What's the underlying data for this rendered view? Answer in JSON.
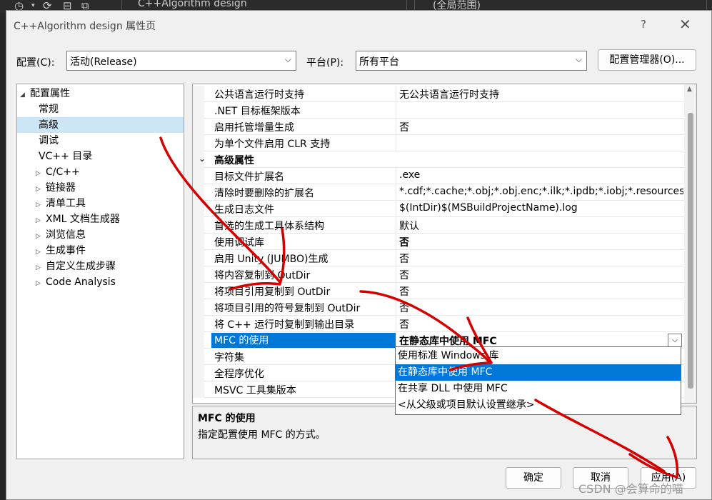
{
  "ide": {
    "tab_title": "C++Algorithm design",
    "scope": "(全局范围)"
  },
  "dialog": {
    "title": "C++Algorithm design 属性页",
    "help": "?",
    "close": "✕"
  },
  "config": {
    "label": "配置(C):",
    "value": "活动(Release)",
    "platform_label": "平台(P):",
    "platform_value": "所有平台",
    "manager_button": "配置管理器(O)..."
  },
  "tree": [
    {
      "label": "配置属性",
      "expander": "◢"
    },
    {
      "label": "常规",
      "expander": ""
    },
    {
      "label": "高级",
      "expander": "",
      "selected": true
    },
    {
      "label": "调试",
      "expander": ""
    },
    {
      "label": "VC++ 目录",
      "expander": ""
    },
    {
      "label": "C/C++",
      "expander": "▷"
    },
    {
      "label": "链接器",
      "expander": "▷"
    },
    {
      "label": "清单工具",
      "expander": "▷"
    },
    {
      "label": "XML 文档生成器",
      "expander": "▷"
    },
    {
      "label": "浏览信息",
      "expander": "▷"
    },
    {
      "label": "生成事件",
      "expander": "▷"
    },
    {
      "label": "自定义生成步骤",
      "expander": "▷"
    },
    {
      "label": "Code Analysis",
      "expander": "▷"
    }
  ],
  "grid": {
    "rows": [
      {
        "name": "公共语言运行时支持",
        "value": "无公共语言运行时支持"
      },
      {
        "name": ".NET 目标框架版本",
        "value": ""
      },
      {
        "name": "启用托管增量生成",
        "value": "否"
      },
      {
        "name": "为单个文件启用 CLR 支持",
        "value": ""
      },
      {
        "name": "高级属性",
        "value": "",
        "category": true,
        "expander": "⌄"
      },
      {
        "name": "目标文件扩展名",
        "value": ".exe"
      },
      {
        "name": "清除时要删除的扩展名",
        "value": "*.cdf;*.cache;*.obj;*.obj.enc;*.ilk;*.ipdb;*.iobj;*.resources"
      },
      {
        "name": "生成日志文件",
        "value": "$(IntDir)$(MSBuildProjectName).log"
      },
      {
        "name": "首选的生成工具体系结构",
        "value": "默认"
      },
      {
        "name": "使用调试库",
        "value": "否",
        "bold": true
      },
      {
        "name": "启用 Unity (JUMBO)生成",
        "value": "否"
      },
      {
        "name": "将内容复制到 OutDir",
        "value": "否"
      },
      {
        "name": "将项目引用复制到 OutDir",
        "value": "否"
      },
      {
        "name": "将项目引用的符号复制到 OutDir",
        "value": "否"
      },
      {
        "name": "将 C++ 运行时复制到输出目录",
        "value": "否"
      },
      {
        "name": "MFC 的使用",
        "value": "在静态库中使用 MFC",
        "selected": true,
        "bold": true
      },
      {
        "name": "字符集",
        "value": ""
      },
      {
        "name": "全程序优化",
        "value": ""
      },
      {
        "name": "MSVC 工具集版本",
        "value": ""
      }
    ],
    "dropdown_arrow": "⌵"
  },
  "dropdown": {
    "options": [
      {
        "label": "使用标准 Windows 库"
      },
      {
        "label": "在静态库中使用 MFC",
        "selected": true
      },
      {
        "label": "在共享 DLL 中使用 MFC"
      },
      {
        "label": "<从父级或项目默认设置继承>"
      }
    ]
  },
  "description": {
    "title": "MFC 的使用",
    "text": "指定配置使用 MFC 的方式。"
  },
  "buttons": {
    "ok": "确定",
    "cancel": "取消",
    "apply": "应用(A)"
  },
  "watermark": "CSDN @会算命的喵",
  "colors": {
    "selection": "#0078d7",
    "tree_selection": "#cde6f7",
    "annotation": "#d40000"
  }
}
